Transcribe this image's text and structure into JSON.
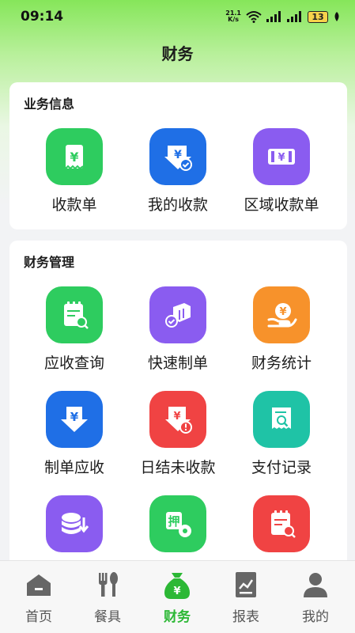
{
  "status_bar": {
    "time": "09:14",
    "net_speed_value": "21.1",
    "net_speed_unit": "K/s",
    "battery": "13"
  },
  "page_title": "财务",
  "business_info": {
    "title": "业务信息",
    "items": [
      {
        "label": "收款单",
        "icon": "receipt-yen-icon",
        "color": "#2ecc5f"
      },
      {
        "label": "我的收款",
        "icon": "yen-download-check-icon",
        "color": "#1f6fe6"
      },
      {
        "label": "区域收款单",
        "icon": "banknote-icon",
        "color": "#8a5cf0"
      }
    ]
  },
  "finance_management": {
    "title": "财务管理",
    "items": [
      {
        "label": "应收查询",
        "icon": "notepad-search-icon",
        "color": "#2ecc5f"
      },
      {
        "label": "快速制单",
        "icon": "boxes-check-icon",
        "color": "#8a5cf0"
      },
      {
        "label": "财务统计",
        "icon": "coin-hand-icon",
        "color": "#f7922b"
      },
      {
        "label": "制单应收",
        "icon": "yen-arrow-down-icon",
        "color": "#1f6fe6"
      },
      {
        "label": "日结未收款",
        "icon": "yen-alert-icon",
        "color": "#f04343"
      },
      {
        "label": "支付记录",
        "icon": "receipt-search-icon",
        "color": "#1fc3a6"
      },
      {
        "label": "",
        "icon": "coins-download-icon",
        "color": "#8a5cf0"
      },
      {
        "label": "",
        "icon": "deposit-gear-icon",
        "color": "#2ecc5f"
      },
      {
        "label": "",
        "icon": "clipboard-search-icon",
        "color": "#f04343"
      }
    ]
  },
  "tabs": [
    {
      "label": "首页",
      "icon": "home-icon",
      "active": false
    },
    {
      "label": "餐具",
      "icon": "fork-spoon-icon",
      "active": false
    },
    {
      "label": "财务",
      "icon": "money-bag-icon",
      "active": true
    },
    {
      "label": "报表",
      "icon": "report-chart-icon",
      "active": false
    },
    {
      "label": "我的",
      "icon": "user-icon",
      "active": false
    }
  ],
  "colors": {
    "accent_green": "#2cb835",
    "header_green": "#86e65a"
  }
}
